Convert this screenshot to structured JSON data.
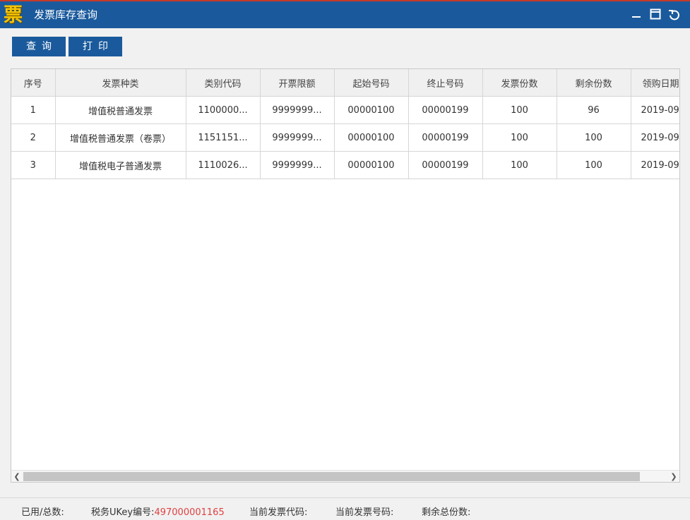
{
  "window": {
    "logo_char": "票",
    "title": "发票库存查询"
  },
  "toolbar": {
    "query_label": "查询",
    "print_label": "打印"
  },
  "table": {
    "columns": [
      "序号",
      "发票种类",
      "类别代码",
      "开票限额",
      "起始号码",
      "终止号码",
      "发票份数",
      "剩余份数",
      "领购日期"
    ],
    "rows": [
      [
        "1",
        "增值税普通发票",
        "1100000...",
        "9999999...",
        "00000100",
        "00000199",
        "100",
        "96",
        "2019-09"
      ],
      [
        "2",
        "增值税普通发票（卷票）",
        "1151151...",
        "9999999...",
        "00000100",
        "00000199",
        "100",
        "100",
        "2019-09"
      ],
      [
        "3",
        "增值税电子普通发票",
        "1110026...",
        "9999999...",
        "00000100",
        "00000199",
        "100",
        "100",
        "2019-09"
      ]
    ]
  },
  "status": {
    "used_total_label": "已用/总数:",
    "ukey_label": "税务UKey编号:",
    "ukey_value": "497000001165",
    "current_code_label": "当前发票代码:",
    "current_number_label": "当前发票号码:",
    "remaining_label": "剩余总份数:"
  },
  "colors": {
    "titlebar": "#1a5a9c",
    "accent_value": "#e14040"
  }
}
